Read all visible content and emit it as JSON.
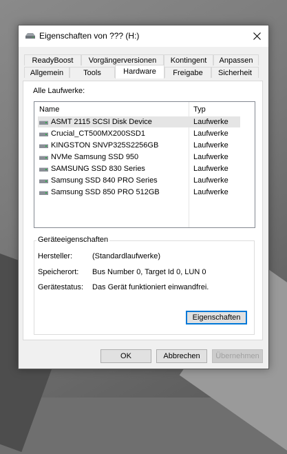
{
  "window": {
    "title": "Eigenschaften von ??? (H:)"
  },
  "tabs": {
    "row_top": [
      "ReadyBoost",
      "Vorgängerversionen",
      "Kontingent",
      "Anpassen"
    ],
    "row_bottom": [
      "Allgemein",
      "Tools",
      "Hardware",
      "Freigabe",
      "Sicherheit"
    ],
    "active": "Hardware"
  },
  "hardware": {
    "all_drives_label": "Alle Laufwerke:",
    "columns": {
      "name": "Name",
      "type": "Typ"
    },
    "drives": [
      {
        "name": "ASMT 2115 SCSI Disk Device",
        "type": "Laufwerke"
      },
      {
        "name": "Crucial_CT500MX200SSD1",
        "type": "Laufwerke"
      },
      {
        "name": "KINGSTON SNVP325S2256GB",
        "type": "Laufwerke"
      },
      {
        "name": "NVMe Samsung SSD 950",
        "type": "Laufwerke"
      },
      {
        "name": "SAMSUNG SSD 830 Series",
        "type": "Laufwerke"
      },
      {
        "name": "Samsung SSD 840 PRO Series",
        "type": "Laufwerke"
      },
      {
        "name": "Samsung SSD 850 PRO 512GB",
        "type": "Laufwerke"
      }
    ],
    "selected_index": 0,
    "device_properties": {
      "group_title": "Geräteeigenschaften",
      "manufacturer_label": "Hersteller:",
      "manufacturer_value": "(Standardlaufwerke)",
      "location_label": "Speicherort:",
      "location_value": "Bus Number 0, Target Id 0, LUN 0",
      "status_label": "Gerätestatus:",
      "status_value": "Das Gerät funktioniert einwandfrei.",
      "properties_button": "Eigenschaften"
    }
  },
  "buttons": {
    "ok": "OK",
    "cancel": "Abbrechen",
    "apply": "Übernehmen"
  },
  "icons": {
    "window": "drive-icon",
    "close": "close-icon",
    "drive": "drive-icon"
  }
}
